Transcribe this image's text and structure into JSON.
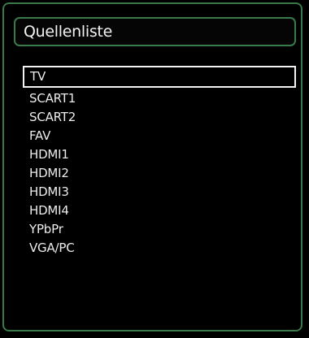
{
  "menu": {
    "title": "Quellenliste",
    "selected_index": 0,
    "items": [
      {
        "label": "TV"
      },
      {
        "label": "SCART1"
      },
      {
        "label": "SCART2"
      },
      {
        "label": "FAV"
      },
      {
        "label": "HDMI1"
      },
      {
        "label": "HDMI2"
      },
      {
        "label": "HDMI3"
      },
      {
        "label": "HDMI4"
      },
      {
        "label": "YPbPr"
      },
      {
        "label": "VGA/PC"
      }
    ]
  },
  "colors": {
    "background": "#000000",
    "border_green": "#3a7a4a",
    "text": "#ececec",
    "selection_border": "#f2f2f2"
  }
}
